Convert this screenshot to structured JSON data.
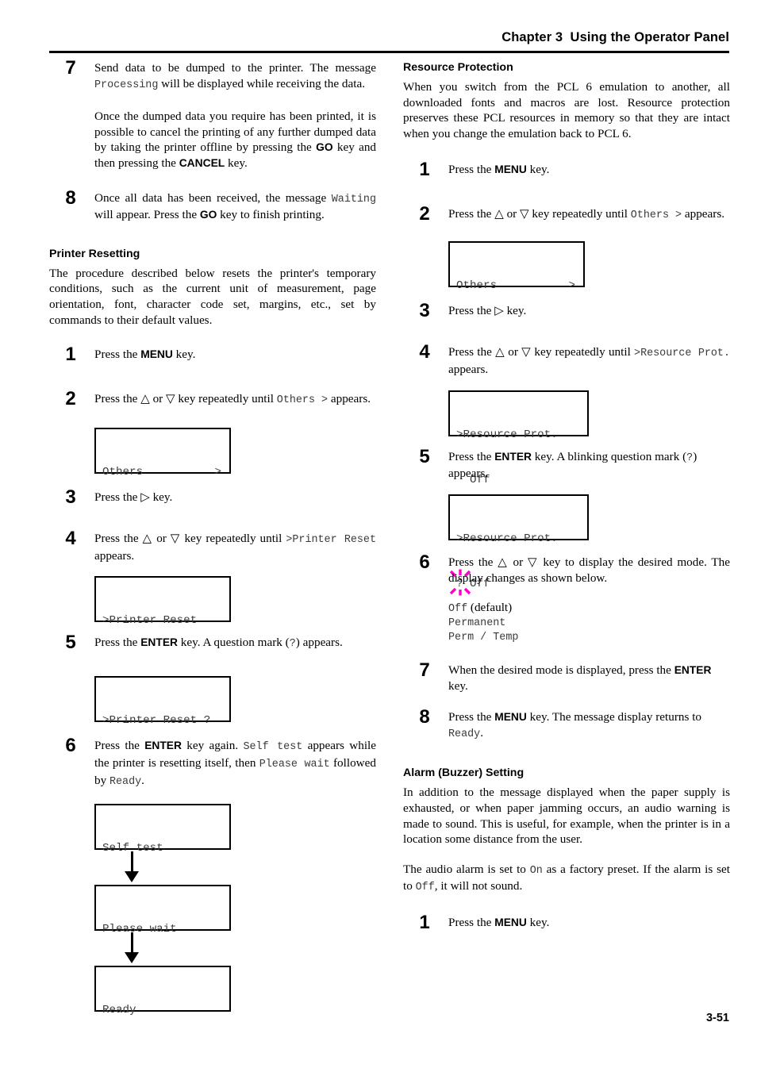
{
  "header": {
    "title": "Chapter 3  Using the Operator Panel"
  },
  "footer": {
    "page_number": "3-51"
  },
  "colors": {
    "step_bar": "#c9c9c9",
    "lcd_text": "#3b3b3b",
    "blink_marker": "#ff00cc",
    "rule": "#000000"
  },
  "left_column": {
    "step7": {
      "number": "7",
      "text_1": "Send data to be dumped to the printer. The message ",
      "mono_1": "Processing",
      "text_2": " will be displayed while receiving the data."
    },
    "step7_note": "Once the dumped data you require has been printed, it is possible to cancel the printing of any further dumped data by taking the printer offline by pressing the ",
    "step7_note_key1": "GO",
    "step7_note_mid": " key and then pressing the ",
    "step7_note_key2": "CANCEL",
    "step7_note_end": " key.",
    "step8": {
      "number": "8",
      "text_1": "Once all data has been received, the message ",
      "mono_1": "Waiting",
      "text_2": " will appear. Press the ",
      "key_1": "GO",
      "text_3": " key to finish printing."
    },
    "printer_resetting": {
      "heading": "Printer Resetting",
      "intro": "The procedure described below resets the printer's temporary conditions, such as the current unit of measurement, page orientation, font, character code set, margins, etc., set by commands to their default values.",
      "step1": {
        "number": "1",
        "text_1": "Press the ",
        "key_1": "MENU",
        "text_2": " key."
      },
      "step2": {
        "number": "2",
        "text_1": "Press the ",
        "tri_up": "△",
        "text_or": " or ",
        "tri_down": "▽",
        "text_2": " key repeatedly until ",
        "mono_1": "Others >",
        "text_3": " appears."
      },
      "lcd_others": {
        "left": "Others",
        "right": ">"
      },
      "step3": {
        "number": "3",
        "text_1": "Press the ",
        "tri_right": "▷",
        "text_2": " key."
      },
      "step4": {
        "number": "4",
        "text_1": "Press the ",
        "tri_up": "△",
        "text_or": " or ",
        "tri_down": "▽",
        "text_2": " key repeatedly until ",
        "mono_1": ">Printer Reset",
        "text_3": " appears."
      },
      "lcd_printer_reset": {
        "line1": ">Printer Reset"
      },
      "step5": {
        "number": "5",
        "text_1": "Press the ",
        "key_1": "ENTER",
        "text_2": " key. A question mark (",
        "mono_q": "?",
        "text_3": ") appears."
      },
      "lcd_printer_reset_q": {
        "line1": ">Printer Reset ?"
      },
      "step6": {
        "number": "6",
        "text_1": "Press the ",
        "key_1": "ENTER",
        "text_2": " key again. ",
        "mono_1": "Self test",
        "text_3": " appears while the printer is resetting itself, then ",
        "mono_2": "Please wait",
        "text_4": " followed by ",
        "mono_3": "Ready",
        "text_5": "."
      },
      "flow": {
        "box1": "Self test",
        "box2": "Please wait",
        "box3": "Ready",
        "arrow_icon": "down-arrow-icon"
      }
    }
  },
  "right_column": {
    "resource_protection": {
      "heading": "Resource Protection",
      "intro": "When you switch from the PCL 6 emulation to another, all downloaded fonts and macros are lost. Resource protection preserves these PCL resources in memory so that they are intact when you change the emulation back to PCL 6.",
      "step1": {
        "number": "1",
        "text_1": "Press the ",
        "key_1": "MENU",
        "text_2": " key."
      },
      "step2": {
        "number": "2",
        "text_1": "Press the ",
        "tri_up": "△",
        "text_or": " or ",
        "tri_down": "▽",
        "text_2": " key repeatedly until ",
        "mono_1": "Others >",
        "text_3": " appears."
      },
      "lcd_others": {
        "left": "Others",
        "right": ">"
      },
      "step3": {
        "number": "3",
        "text_1": "Press the ",
        "tri_right": "▷",
        "text_2": " key."
      },
      "step4": {
        "number": "4",
        "text_1": "Press the ",
        "tri_up": "△",
        "text_or": " or ",
        "tri_down": "▽",
        "text_2": " key repeatedly until ",
        "mono_1": ">Resource Prot.",
        "text_3": " appears."
      },
      "lcd_resource_off": {
        "line1": ">Resource Prot.",
        "line2": "  Off"
      },
      "step5": {
        "number": "5",
        "text_1": "Press the ",
        "key_1": "ENTER",
        "text_2": " key. A blinking question mark (",
        "mono_q": "?",
        "text_3": ") appears."
      },
      "lcd_resource_blink": {
        "line1": ">Resource Prot.",
        "blink_char": "?",
        "line2_rest": " Off"
      },
      "step6": {
        "number": "6",
        "text_1": "Press the ",
        "tri_up": "△",
        "text_or": " or ",
        "tri_down": "▽",
        "text_2": " key to display the desired mode. The display changes as shown below."
      },
      "modes": [
        {
          "mono": "Off",
          "note": " (default)"
        },
        {
          "mono": "Permanent",
          "note": ""
        },
        {
          "mono": "Perm / Temp",
          "note": ""
        }
      ],
      "step7": {
        "number": "7",
        "text_1": "When the desired mode is displayed, press the ",
        "key_1": "ENTER",
        "text_2": " key."
      },
      "step8": {
        "number": "8",
        "text_1": "Press the ",
        "key_1": "MENU",
        "text_2": " key. The message display returns to ",
        "mono_1": "Ready",
        "text_3": "."
      }
    },
    "alarm_setting": {
      "heading": "Alarm (Buzzer) Setting",
      "para1": "In addition to the message displayed when the paper supply is exhausted, or when paper jamming occurs, an audio warning is made to sound. This is useful, for example, when the printer is in a location some distance from the user.",
      "para2_a": "The audio alarm is set to ",
      "para2_mono_on": "On",
      "para2_b": " as a factory preset. If the alarm is set to ",
      "para2_mono_off": "Off",
      "para2_c": ", it will not sound.",
      "step1": {
        "number": "1",
        "text_1": "Press the ",
        "key_1": "MENU",
        "text_2": " key."
      }
    }
  }
}
